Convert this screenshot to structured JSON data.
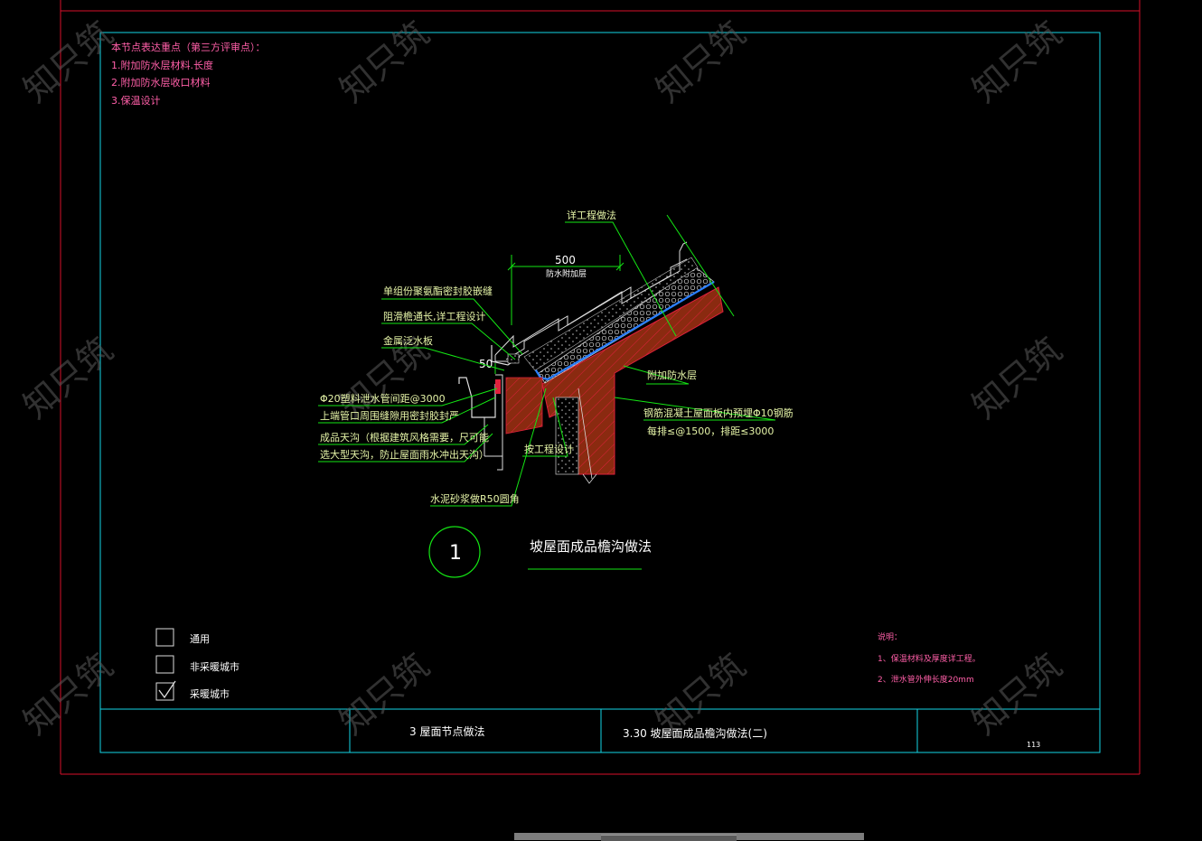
{
  "review_notes": {
    "heading": "本节点表达重点（第三方评审点）：",
    "items": [
      "1.附加防水层材料.长度",
      "2.附加防水层收口材料",
      "3.保温设计"
    ]
  },
  "callouts": {
    "detail_engineering": "详工程做法",
    "dim_500": "500",
    "dim_500_note": "防水附加层",
    "sealant": "单组份聚氨酯密封胶嵌缝",
    "gutter_length": "阻滑檐通长,详工程设计",
    "flashing": "金属泛水板",
    "dim_50": "50",
    "drain_pipe_1": "Φ20塑料泄水管间距@3000",
    "drain_pipe_2": "上端管口周围缝隙用密封胶封严",
    "gutter_1": "成品天沟（根据建筑风格需要，尺可能",
    "gutter_2": "选大型天沟，防止屋面雨水冲出天沟）",
    "engineering_design": "按工程设计",
    "mortar": "水泥砂浆做R50圆角",
    "extra_waterproof": "附加防水层",
    "rebar_1": "钢筋混凝土屋面板内预埋Φ10钢筋",
    "rebar_2": "每排≤@1500，排距≤3000"
  },
  "detail": {
    "number": "1",
    "title": "坡屋面成品檐沟做法"
  },
  "legend": {
    "items": [
      {
        "label": "通用",
        "checked": false
      },
      {
        "label": "非采暖城市",
        "checked": false
      },
      {
        "label": "采暖城市",
        "checked": true
      }
    ]
  },
  "notes": {
    "heading": "说明：",
    "items": [
      "1、保温材料及厚度详工程。",
      "2、泄水管外伸长度20mm"
    ]
  },
  "title_block": {
    "section": "3  屋面节点做法",
    "drawing_title": "3.30  坡屋面成品檐沟做法(二)",
    "page": "113"
  },
  "watermark": "知只筑",
  "colors": {
    "border_red": "#d8102a",
    "frame_cyan": "#14d6e6",
    "line_green": "#14e614",
    "hatch_red": "#e0203c",
    "membrane_blue": "#2a7fff",
    "annot_pink": "#ff5fa8"
  }
}
